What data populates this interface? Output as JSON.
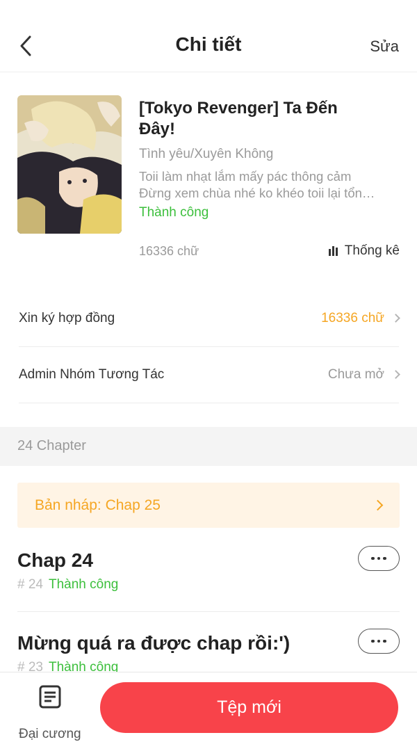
{
  "header": {
    "title": "Chi tiết",
    "edit_label": "Sửa"
  },
  "book": {
    "title": "[Tokyo Revenger] Ta Đến Đây!",
    "genre": "Tình yêu/Xuyên Không",
    "description_line1": "Toii làm nhạt lắm mấy pác thông cảm",
    "description_line2": "Đừng xem chùa nhé ko khéo toii lại tổn…",
    "status": "Thành công",
    "word_count": "16336 chữ",
    "stats_label": "Thống kê"
  },
  "settings": [
    {
      "label": "Xin ký hợp đồng",
      "value": "16336 chữ",
      "value_color": "#f5a623"
    },
    {
      "label": "Admin Nhóm Tương Tác",
      "value": "Chưa mở",
      "value_color": "#9a9a9a"
    }
  ],
  "chapters_section": {
    "count_label": "24 Chapter",
    "draft_label": "Bản nháp: Chap 25",
    "items": [
      {
        "title": "Chap 24",
        "number": "# 24",
        "status": "Thành công"
      },
      {
        "title": "Mừng quá ra được chap rồi:')",
        "number": "# 23",
        "status": "Thành công"
      }
    ]
  },
  "bottom_bar": {
    "outline_label": "Đại cương",
    "new_button_label": "Tệp mới"
  },
  "colors": {
    "accent_red": "#f8434a",
    "success_green": "#3cbf3c",
    "draft_orange": "#f5a623"
  }
}
